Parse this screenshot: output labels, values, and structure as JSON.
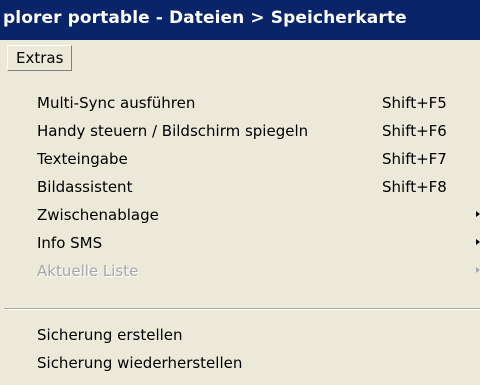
{
  "window": {
    "title": "plorer portable - Dateien > Speicherkarte"
  },
  "menubar": {
    "active_menu": "Extras"
  },
  "menu": {
    "items": [
      {
        "label": "Multi-Sync ausführen",
        "shortcut": "Shift+F5"
      },
      {
        "label": "Handy steuern / Bildschirm spiegeln",
        "shortcut": "Shift+F6"
      },
      {
        "label": "Texteingabe",
        "shortcut": "Shift+F7"
      },
      {
        "label": "Bildassistent",
        "shortcut": "Shift+F8"
      },
      {
        "label": "Zwischenablage",
        "submenu": true
      },
      {
        "label": "Info SMS",
        "submenu": true
      },
      {
        "label": "Aktuelle Liste",
        "submenu": true,
        "disabled": true
      },
      {
        "label": "Sicherung erstellen"
      },
      {
        "label": "Sicherung wiederherstellen"
      }
    ]
  },
  "colors": {
    "titlebar": "#0a246a",
    "menu_background": "#ece9d8",
    "disabled_text": "#a7a6aa"
  }
}
